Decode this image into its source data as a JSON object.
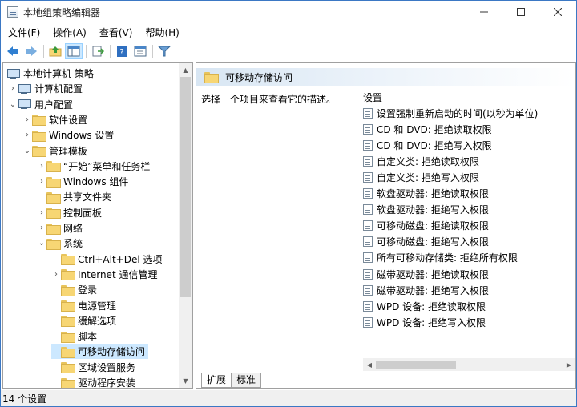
{
  "window": {
    "title": "本地组策略编辑器"
  },
  "menu": [
    "文件(F)",
    "操作(A)",
    "查看(V)",
    "帮助(H)"
  ],
  "toolbar": [
    "back-icon",
    "forward-icon",
    "up-folder-icon",
    "show-hide-tree-icon",
    "export-list-icon",
    "help-icon",
    "properties-icon",
    "filter-icon"
  ],
  "tree": {
    "items": [
      {
        "label": "本地计算机 策略",
        "level": 0,
        "expander": "",
        "icon": "computer-icon"
      },
      {
        "label": "计算机配置",
        "level": 1,
        "expander": "›",
        "icon": "computer-icon"
      },
      {
        "label": "用户配置",
        "level": 1,
        "expander": "⌄",
        "icon": "user-icon"
      },
      {
        "label": "软件设置",
        "level": 2,
        "expander": "›",
        "icon": "folder-icon"
      },
      {
        "label": "Windows 设置",
        "level": 2,
        "expander": "›",
        "icon": "folder-icon"
      },
      {
        "label": "管理模板",
        "level": 2,
        "expander": "⌄",
        "icon": "folder-icon"
      },
      {
        "label": "“开始”菜单和任务栏",
        "level": 3,
        "expander": "›",
        "icon": "folder-icon"
      },
      {
        "label": "Windows 组件",
        "level": 3,
        "expander": "›",
        "icon": "folder-icon"
      },
      {
        "label": "共享文件夹",
        "level": 3,
        "expander": "",
        "icon": "folder-icon"
      },
      {
        "label": "控制面板",
        "level": 3,
        "expander": "›",
        "icon": "folder-icon"
      },
      {
        "label": "网络",
        "level": 3,
        "expander": "›",
        "icon": "folder-icon"
      },
      {
        "label": "系统",
        "level": 3,
        "expander": "⌄",
        "icon": "folder-icon"
      },
      {
        "label": "Ctrl+Alt+Del 选项",
        "level": 4,
        "expander": "",
        "icon": "folder-icon"
      },
      {
        "label": "Internet 通信管理",
        "level": 4,
        "expander": "›",
        "icon": "folder-icon"
      },
      {
        "label": "登录",
        "level": 4,
        "expander": "",
        "icon": "folder-icon"
      },
      {
        "label": "电源管理",
        "level": 4,
        "expander": "",
        "icon": "folder-icon"
      },
      {
        "label": "缓解选项",
        "level": 4,
        "expander": "",
        "icon": "folder-icon"
      },
      {
        "label": "脚本",
        "level": 4,
        "expander": "",
        "icon": "folder-icon"
      },
      {
        "label": "可移动存储访问",
        "level": 4,
        "expander": "",
        "icon": "folder-icon",
        "selected": true
      },
      {
        "label": "区域设置服务",
        "level": 4,
        "expander": "",
        "icon": "folder-icon"
      },
      {
        "label": "驱动程序安装",
        "level": 4,
        "expander": "",
        "icon": "folder-icon"
      }
    ]
  },
  "right": {
    "header": "可移动存储访问",
    "description": "选择一个项目来查看它的描述。",
    "column_header": "设置",
    "policies": [
      "设置强制重新启动的时间(以秒为单位)",
      "CD 和 DVD: 拒绝读取权限",
      "CD 和 DVD: 拒绝写入权限",
      "自定义类: 拒绝读取权限",
      "自定义类: 拒绝写入权限",
      "软盘驱动器: 拒绝读取权限",
      "软盘驱动器: 拒绝写入权限",
      "可移动磁盘: 拒绝读取权限",
      "可移动磁盘: 拒绝写入权限",
      "所有可移动存储类: 拒绝所有权限",
      "磁带驱动器: 拒绝读取权限",
      "磁带驱动器: 拒绝写入权限",
      "WPD 设备: 拒绝读取权限",
      "WPD 设备: 拒绝写入权限"
    ],
    "tabs": [
      "扩展",
      "标准"
    ],
    "active_tab": "扩展"
  },
  "status": {
    "text": "14 个设置"
  }
}
